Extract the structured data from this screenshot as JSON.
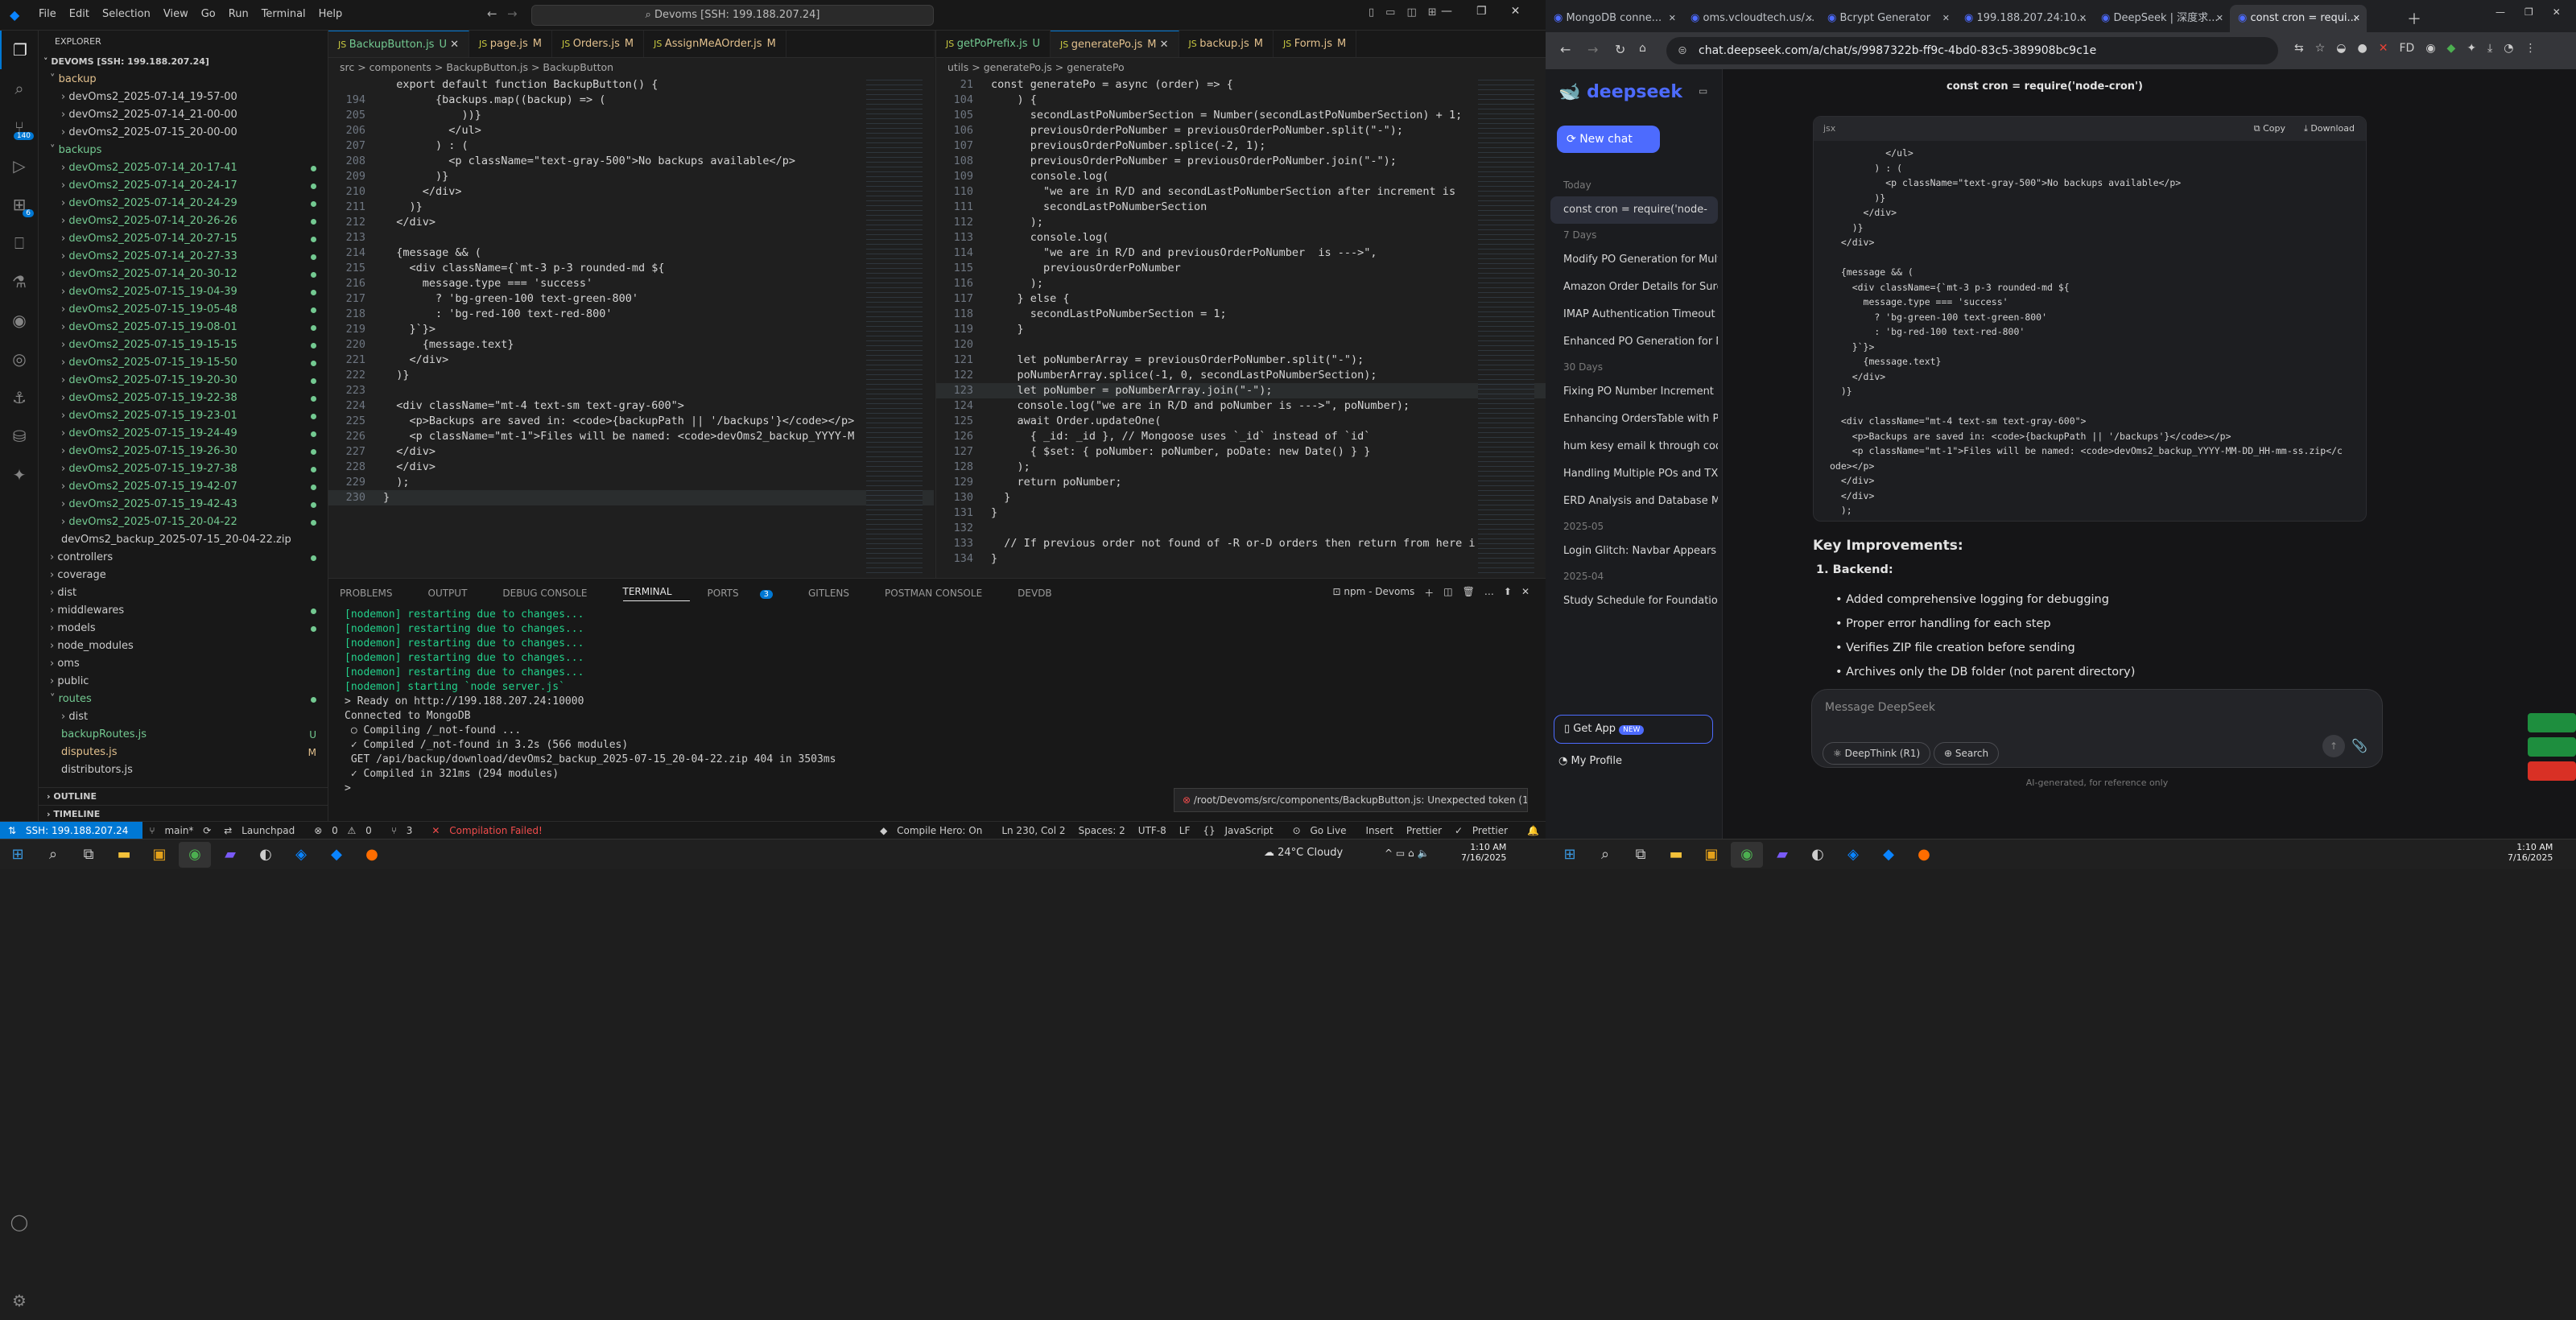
{
  "vscode": {
    "menu": [
      "File",
      "Edit",
      "Selection",
      "View",
      "Go",
      "Run",
      "Terminal",
      "Help"
    ],
    "command_center": "Devoms [SSH: 199.188.207.24]",
    "explorer": {
      "title": "EXPLORER",
      "root": "DEVOMS [SSH: 199.188.207.24]",
      "items": [
        {
          "label": "backup",
          "indent": 1,
          "kind": "folder-open",
          "color": "y"
        },
        {
          "label": "devOms2_2025-07-14_19-57-00",
          "indent": 2,
          "kind": "folder",
          "color": ""
        },
        {
          "label": "devOms2_2025-07-14_21-00-00",
          "indent": 2,
          "kind": "folder",
          "color": ""
        },
        {
          "label": "devOms2_2025-07-15_20-00-00",
          "indent": 2,
          "kind": "folder",
          "color": ""
        },
        {
          "label": "backups",
          "indent": 1,
          "kind": "folder-open",
          "color": "g"
        },
        {
          "label": "devOms2_2025-07-14_20-17-41",
          "indent": 2,
          "kind": "folder",
          "color": "g",
          "dot": true
        },
        {
          "label": "devOms2_2025-07-14_20-24-17",
          "indent": 2,
          "kind": "folder",
          "color": "g",
          "dot": true
        },
        {
          "label": "devOms2_2025-07-14_20-24-29",
          "indent": 2,
          "kind": "folder",
          "color": "g",
          "dot": true
        },
        {
          "label": "devOms2_2025-07-14_20-26-26",
          "indent": 2,
          "kind": "folder",
          "color": "g",
          "dot": true
        },
        {
          "label": "devOms2_2025-07-14_20-27-15",
          "indent": 2,
          "kind": "folder",
          "color": "g",
          "dot": true
        },
        {
          "label": "devOms2_2025-07-14_20-27-33",
          "indent": 2,
          "kind": "folder",
          "color": "g",
          "dot": true
        },
        {
          "label": "devOms2_2025-07-14_20-30-12",
          "indent": 2,
          "kind": "folder",
          "color": "g",
          "dot": true
        },
        {
          "label": "devOms2_2025-07-15_19-04-39",
          "indent": 2,
          "kind": "folder",
          "color": "g",
          "dot": true
        },
        {
          "label": "devOms2_2025-07-15_19-05-48",
          "indent": 2,
          "kind": "folder",
          "color": "g",
          "dot": true
        },
        {
          "label": "devOms2_2025-07-15_19-08-01",
          "indent": 2,
          "kind": "folder",
          "color": "g",
          "dot": true
        },
        {
          "label": "devOms2_2025-07-15_19-15-15",
          "indent": 2,
          "kind": "folder",
          "color": "g",
          "dot": true
        },
        {
          "label": "devOms2_2025-07-15_19-15-50",
          "indent": 2,
          "kind": "folder",
          "color": "g",
          "dot": true
        },
        {
          "label": "devOms2_2025-07-15_19-20-30",
          "indent": 2,
          "kind": "folder",
          "color": "g",
          "dot": true
        },
        {
          "label": "devOms2_2025-07-15_19-22-38",
          "indent": 2,
          "kind": "folder",
          "color": "g",
          "dot": true
        },
        {
          "label": "devOms2_2025-07-15_19-23-01",
          "indent": 2,
          "kind": "folder",
          "color": "g",
          "dot": true
        },
        {
          "label": "devOms2_2025-07-15_19-24-49",
          "indent": 2,
          "kind": "folder",
          "color": "g",
          "dot": true
        },
        {
          "label": "devOms2_2025-07-15_19-26-30",
          "indent": 2,
          "kind": "folder",
          "color": "g",
          "dot": true
        },
        {
          "label": "devOms2_2025-07-15_19-27-38",
          "indent": 2,
          "kind": "folder",
          "color": "g",
          "dot": true
        },
        {
          "label": "devOms2_2025-07-15_19-42-07",
          "indent": 2,
          "kind": "folder",
          "color": "g",
          "dot": true
        },
        {
          "label": "devOms2_2025-07-15_19-42-43",
          "indent": 2,
          "kind": "folder",
          "color": "g",
          "dot": true
        },
        {
          "label": "devOms2_2025-07-15_20-04-22",
          "indent": 2,
          "kind": "folder",
          "color": "g",
          "dot": true
        },
        {
          "label": "devOms2_backup_2025-07-15_20-04-22.zip",
          "indent": 2,
          "kind": "file",
          "color": ""
        },
        {
          "label": "controllers",
          "indent": 1,
          "kind": "folder",
          "color": "",
          "dot": true
        },
        {
          "label": "coverage",
          "indent": 1,
          "kind": "folder",
          "color": ""
        },
        {
          "label": "dist",
          "indent": 1,
          "kind": "folder",
          "color": ""
        },
        {
          "label": "middlewares",
          "indent": 1,
          "kind": "folder",
          "color": "",
          "dot": true
        },
        {
          "label": "models",
          "indent": 1,
          "kind": "folder",
          "color": "",
          "dot": true
        },
        {
          "label": "node_modules",
          "indent": 1,
          "kind": "folder",
          "color": ""
        },
        {
          "label": "oms",
          "indent": 1,
          "kind": "folder",
          "color": ""
        },
        {
          "label": "public",
          "indent": 1,
          "kind": "folder",
          "color": ""
        },
        {
          "label": "routes",
          "indent": 1,
          "kind": "folder-open",
          "color": "g",
          "dot": true
        },
        {
          "label": "dist",
          "indent": 2,
          "kind": "folder",
          "color": ""
        },
        {
          "label": "backupRoutes.js",
          "indent": 2,
          "kind": "file",
          "color": "g",
          "stat": "U"
        },
        {
          "label": "disputes.js",
          "indent": 2,
          "kind": "file",
          "color": "y",
          "stat": "M"
        },
        {
          "label": "distributors.js",
          "indent": 2,
          "kind": "file",
          "color": ""
        }
      ],
      "outline": "OUTLINE",
      "timeline": "TIMELINE"
    },
    "left_editor": {
      "tabs": [
        {
          "label": "BackupButton.js",
          "mark": "U",
          "active": true
        },
        {
          "label": "page.js",
          "mark": "M"
        },
        {
          "label": "Orders.js",
          "mark": "M"
        },
        {
          "label": "AssignMeAOrder.js",
          "mark": "M"
        }
      ],
      "breadcrumb": "src > components > BackupButton.js > BackupButton",
      "lines": [
        {
          "n": "",
          "t": "  export default function BackupButton() {"
        },
        {
          "n": "194",
          "t": "        {backups.map((backup) => ("
        },
        {
          "n": "205",
          "t": "            ))}"
        },
        {
          "n": "206",
          "t": "          </ul>"
        },
        {
          "n": "207",
          "t": "        ) : ("
        },
        {
          "n": "208",
          "t": "          <p className=\"text-gray-500\">No backups available</p>"
        },
        {
          "n": "209",
          "t": "        )}"
        },
        {
          "n": "210",
          "t": "      </div>"
        },
        {
          "n": "211",
          "t": "    )}"
        },
        {
          "n": "212",
          "t": "  </div>"
        },
        {
          "n": "213",
          "t": ""
        },
        {
          "n": "214",
          "t": "  {message && ("
        },
        {
          "n": "215",
          "t": "    <div className={`mt-3 p-3 rounded-md ${"
        },
        {
          "n": "216",
          "t": "      message.type === 'success'"
        },
        {
          "n": "217",
          "t": "        ? 'bg-green-100 text-green-800'"
        },
        {
          "n": "218",
          "t": "        : 'bg-red-100 text-red-800'"
        },
        {
          "n": "219",
          "t": "    }`}>"
        },
        {
          "n": "220",
          "t": "      {message.text}"
        },
        {
          "n": "221",
          "t": "    </div>"
        },
        {
          "n": "222",
          "t": "  )}"
        },
        {
          "n": "223",
          "t": ""
        },
        {
          "n": "224",
          "t": "  <div className=\"mt-4 text-sm text-gray-600\">"
        },
        {
          "n": "225",
          "t": "    <p>Backups are saved in: <code>{backupPath || '/backups'}</code></p>"
        },
        {
          "n": "226",
          "t": "    <p className=\"mt-1\">Files will be named: <code>devOms2_backup_YYYY-M"
        },
        {
          "n": "227",
          "t": "  </div>"
        },
        {
          "n": "228",
          "t": "  </div>"
        },
        {
          "n": "229",
          "t": "  );"
        },
        {
          "n": "230",
          "t": "}"
        }
      ]
    },
    "right_editor": {
      "tabs": [
        {
          "label": "getPoPrefix.js",
          "mark": "U"
        },
        {
          "label": "generatePo.js",
          "mark": "M",
          "active": true
        },
        {
          "label": "backup.js",
          "mark": "M"
        },
        {
          "label": "Form.js",
          "mark": "M"
        }
      ],
      "breadcrumb": "utils > generatePo.js > generatePo",
      "lines": [
        {
          "n": "21",
          "t": "const generatePo = async (order) => {"
        },
        {
          "n": "104",
          "t": "    ) {"
        },
        {
          "n": "105",
          "t": "      secondLastPoNumberSection = Number(secondLastPoNumberSection) + 1;"
        },
        {
          "n": "106",
          "t": "      previousOrderPoNumber = previousOrderPoNumber.split(\"-\");"
        },
        {
          "n": "107",
          "t": "      previousOrderPoNumber.splice(-2, 1);"
        },
        {
          "n": "108",
          "t": "      previousOrderPoNumber = previousOrderPoNumber.join(\"-\");"
        },
        {
          "n": "109",
          "t": "      console.log("
        },
        {
          "n": "110",
          "t": "        \"we are in R/D and secondLastPoNumberSection after increment is"
        },
        {
          "n": "111",
          "t": "        secondLastPoNumberSection"
        },
        {
          "n": "112",
          "t": "      );"
        },
        {
          "n": "113",
          "t": "      console.log("
        },
        {
          "n": "114",
          "t": "        \"we are in R/D and previousOrderPoNumber  is --->\","
        },
        {
          "n": "115",
          "t": "        previousOrderPoNumber"
        },
        {
          "n": "116",
          "t": "      );"
        },
        {
          "n": "117",
          "t": "    } else {"
        },
        {
          "n": "118",
          "t": "      secondLastPoNumberSection = 1;"
        },
        {
          "n": "119",
          "t": "    }"
        },
        {
          "n": "120",
          "t": ""
        },
        {
          "n": "121",
          "t": "    let poNumberArray = previousOrderPoNumber.split(\"-\");"
        },
        {
          "n": "122",
          "t": "    poNumberArray.splice(-1, 0, secondLastPoNumberSection);"
        },
        {
          "n": "123",
          "t": "    let poNumber = poNumberArray.join(\"-\");"
        },
        {
          "n": "124",
          "t": "    console.log(\"we are in R/D and poNumber is --->\", poNumber);"
        },
        {
          "n": "125",
          "t": "    await Order.updateOne("
        },
        {
          "n": "126",
          "t": "      { _id: _id }, // Mongoose uses `_id` instead of `id`"
        },
        {
          "n": "127",
          "t": "      { $set: { poNumber: poNumber, poDate: new Date() } }"
        },
        {
          "n": "128",
          "t": "    );"
        },
        {
          "n": "129",
          "t": "    return poNumber;"
        },
        {
          "n": "130",
          "t": "  }"
        },
        {
          "n": "131",
          "t": "}"
        },
        {
          "n": "132",
          "t": ""
        },
        {
          "n": "133",
          "t": "  // If previous order not found of -R or-D orders then return from here i"
        },
        {
          "n": "134",
          "t": "}"
        }
      ]
    },
    "panel": {
      "tabs": [
        "PROBLEMS",
        "OUTPUT",
        "DEBUG CONSOLE",
        "TERMINAL",
        "PORTS",
        "GITLENS",
        "POSTMAN CONSOLE",
        "DEVDB"
      ],
      "ports_badge": "3",
      "terminal_label": "npm - Devoms",
      "lines": [
        "[nodemon] restarting due to changes...",
        "[nodemon] restarting due to changes...",
        "[nodemon] restarting due to changes...",
        "[nodemon] restarting due to changes...",
        "[nodemon] restarting due to changes...",
        "[nodemon] starting `node server.js`",
        "> Ready on http://199.188.207.24:10000",
        "Connected to MongoDB",
        " ○ Compiling /_not-found ...",
        " ✓ Compiled /_not-found in 3.2s (566 modules)",
        " GET /api/backup/download/devOms2_backup_2025-07-15_20-04-22.zip 404 in 3503ms",
        " ✓ Compiled in 321ms (294 modules)",
        ">"
      ],
      "error_toast": "/root/Devoms/src/components/BackupButton.js: Unexpected token (1..."
    },
    "status": {
      "remote": "SSH: 199.188.207.24",
      "branch": "main*",
      "launchpad": "Launchpad",
      "errors": "0",
      "warnings": "0",
      "ports": "3",
      "compile": "Compilation Failed!",
      "compile_hero": "Compile Hero: On",
      "position": "Ln 230, Col 2",
      "spaces": "Spaces: 2",
      "encoding": "UTF-8",
      "eol": "LF",
      "lang": "JavaScript",
      "golive": "Go Live",
      "insert": "Insert",
      "prettier": "Prettier",
      "prettier2": "Prettier"
    },
    "weather": "24°C  Cloudy",
    "clock_time": "1:10 AM",
    "clock_date": "7/16/2025"
  },
  "chrome": {
    "tabs": [
      {
        "label": "MongoDB conne..."
      },
      {
        "label": "oms.vcloudtech.us/..."
      },
      {
        "label": "Bcrypt Generator"
      },
      {
        "label": "199.188.207.24:10..."
      },
      {
        "label": "DeepSeek | 深度求..."
      },
      {
        "label": "const cron = requi...",
        "active": true
      }
    ],
    "url": "chat.deepseek.com/a/chat/s/9987322b-ff9c-4bd0-83c5-389908bc9c1e",
    "deepseek": {
      "brand": "deepseek",
      "new_chat": "New chat",
      "groups": [
        {
          "label": "Today",
          "items": [
            "const cron = require('node-"
          ]
        },
        {
          "label": "7 Days",
          "items": [
            "Modify PO Generation for Multip",
            "Amazon Order Details for Surge",
            "IMAP Authentication Timeout Er",
            "Enhanced PO Generation for Mu"
          ]
        },
        {
          "label": "30 Days",
          "items": [
            "Fixing PO Number Increment Iss",
            "Enhancing OrdersTable with Prev",
            "hum kesy email k through code",
            "Handling Multiple POs and TXW",
            "ERD Analysis and Database Mod"
          ]
        },
        {
          "label": "2025-05",
          "items": [
            "Login Glitch: Navbar Appears Af"
          ]
        },
        {
          "label": "2025-04",
          "items": [
            "Study Schedule for Foundation S"
          ]
        }
      ],
      "get_app": "Get App",
      "new_badge": "NEW",
      "profile": "My Profile",
      "chat_title": "const cron = require('node-cron')",
      "code_lang": "jsx",
      "copy": "Copy",
      "download": "Download",
      "code_lines": [
        "          </ul>",
        "        ) : (",
        "          <p className=\"text-gray-500\">No backups available</p>",
        "        )}",
        "      </div>",
        "    )}",
        "  </div>",
        "",
        "  {message && (",
        "    <div className={`mt-3 p-3 rounded-md ${",
        "      message.type === 'success'",
        "        ? 'bg-green-100 text-green-800'",
        "        : 'bg-red-100 text-red-800'",
        "    }`}>",
        "      {message.text}",
        "    </div>",
        "  )}",
        "",
        "  <div className=\"mt-4 text-sm text-gray-600\">",
        "    <p>Backups are saved in: <code>{backupPath || '/backups'}</code></p>",
        "    <p className=\"mt-1\">Files will be named: <code>devOms2_backup_YYYY-MM-DD_HH-mm-ss.zip</c",
        "ode></p>",
        "  </div>",
        "  </div>",
        "  );",
        "}"
      ],
      "heading": "Key Improvements:",
      "backend_label": "Backend:",
      "bullets": [
        "Added comprehensive logging for debugging",
        "Proper error handling for each step",
        "Verifies ZIP file creation before sending",
        "Archives only the DB folder (not parent directory)"
      ],
      "placeholder": "Message DeepSeek",
      "deepthink": "DeepThink (R1)",
      "search": "Search",
      "disclaimer": "AI-generated, for reference only"
    },
    "clock_time": "1:10 AM",
    "clock_date": "7/16/2025"
  }
}
